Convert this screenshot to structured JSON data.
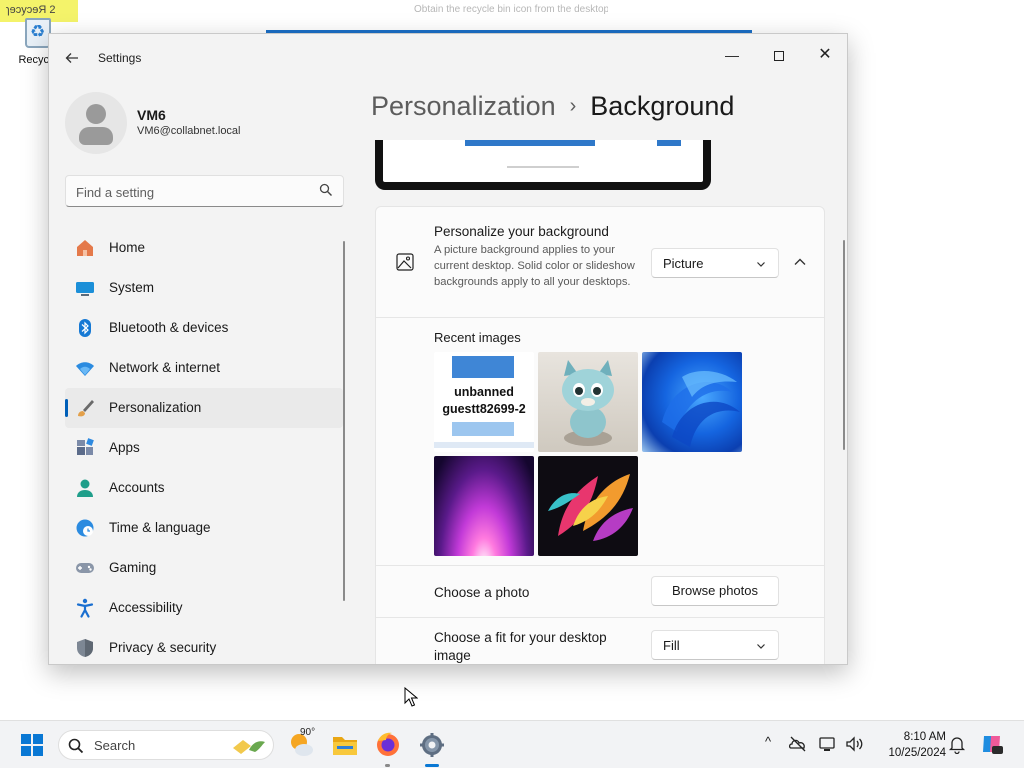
{
  "desktop": {
    "corner_label": "ɿɘɔyɔɘЯ 2",
    "recycle_label": "Recycle",
    "banner_text": "Obtain the recycle bin icon from the desktop"
  },
  "window": {
    "app_title": "Settings",
    "minimize": "—",
    "close": "✕"
  },
  "user": {
    "name": "VM6",
    "email": "VM6@collabnet.local"
  },
  "search": {
    "placeholder": "Find a setting"
  },
  "nav": {
    "items": [
      {
        "label": "Home",
        "icon": "home-icon",
        "active": false
      },
      {
        "label": "System",
        "icon": "system-icon",
        "active": false
      },
      {
        "label": "Bluetooth & devices",
        "icon": "bluetooth-icon",
        "active": false
      },
      {
        "label": "Network & internet",
        "icon": "wifi-icon",
        "active": false
      },
      {
        "label": "Personalization",
        "icon": "brush-icon",
        "active": true
      },
      {
        "label": "Apps",
        "icon": "apps-icon",
        "active": false
      },
      {
        "label": "Accounts",
        "icon": "accounts-icon",
        "active": false
      },
      {
        "label": "Time & language",
        "icon": "clock-globe-icon",
        "active": false
      },
      {
        "label": "Gaming",
        "icon": "gamepad-icon",
        "active": false
      },
      {
        "label": "Accessibility",
        "icon": "accessibility-icon",
        "active": false
      },
      {
        "label": "Privacy & security",
        "icon": "shield-icon",
        "active": false
      }
    ]
  },
  "breadcrumb": {
    "parent": "Personalization",
    "separator": "›",
    "current": "Background"
  },
  "background": {
    "title": "Personalize your background",
    "description": "A picture background applies to your current desktop. Solid color or slideshow backgrounds apply to all your desktops.",
    "type_value": "Picture",
    "recent_label": "Recent images",
    "thumb1_text": "unbanned guestt82699-2",
    "choose_photo_label": "Choose a photo",
    "browse_button": "Browse photos",
    "fit_label": "Choose a fit for your desktop image",
    "fit_value": "Fill"
  },
  "taskbar": {
    "search_label": "Search",
    "weather_temp": "90°",
    "time": "8:10 AM",
    "date": "10/25/2024",
    "tray_chevron": "^"
  },
  "colors": {
    "accent": "#005fb8",
    "taskbar_accent": "#0a78d4",
    "window_bg": "#f3f3f3",
    "card_bg": "#fbfbfb"
  }
}
